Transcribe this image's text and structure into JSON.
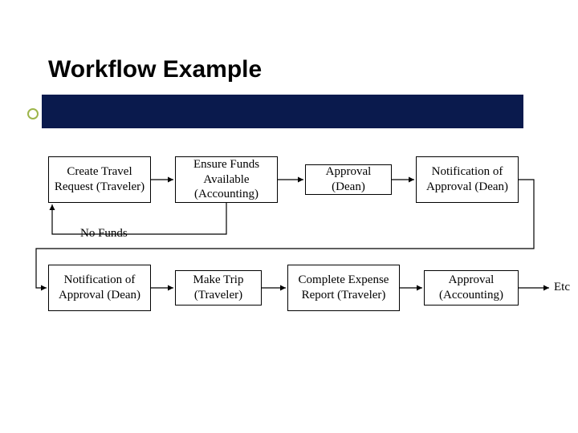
{
  "title": "Workflow Example",
  "boxes": {
    "r1c1": "Create Travel Request (Traveler)",
    "r1c2": "Ensure Funds Available (Accounting)",
    "r1c3": "Approval (Dean)",
    "r1c4": "Notification of Approval (Dean)",
    "r2c1": "Notification of Approval (Dean)",
    "r2c2": "Make Trip (Traveler)",
    "r2c3": "Complete Expense Report (Traveler)",
    "r2c4": "Approval (Accounting)"
  },
  "labels": {
    "nofunds": "No Funds"
  },
  "etc": "Etc",
  "colors": {
    "titleBar": "#0a1a4d",
    "accent": "#9db54a"
  }
}
